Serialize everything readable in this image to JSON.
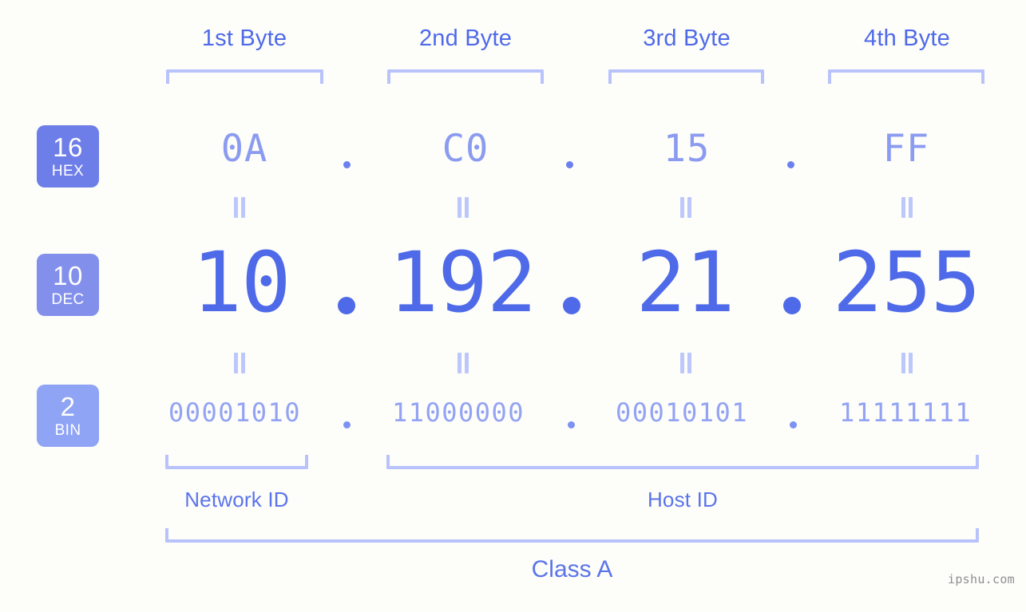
{
  "meta": {
    "watermark": "ipshu.com",
    "background_color": "#fdfdfa",
    "accent_strong": "#4f6ae8",
    "accent_mid": "#8b9bf0",
    "accent_light": "#b9c3fb"
  },
  "byte_headers": [
    {
      "label": "1st Byte"
    },
    {
      "label": "2nd Byte"
    },
    {
      "label": "3rd Byte"
    },
    {
      "label": "4th Byte"
    }
  ],
  "bases": [
    {
      "number": "16",
      "abbr": "HEX",
      "color": "#6e7ee8"
    },
    {
      "number": "10",
      "abbr": "DEC",
      "color": "#8290ec"
    },
    {
      "number": "2",
      "abbr": "BIN",
      "color": "#8fa4f5"
    }
  ],
  "rows": {
    "hex": {
      "values": [
        "0A",
        "C0",
        "15",
        "FF"
      ],
      "separator": "."
    },
    "dec": {
      "values": [
        "10",
        "192",
        "21",
        "255"
      ],
      "separator": "."
    },
    "bin": {
      "values": [
        "00001010",
        "11000000",
        "00010101",
        "11111111"
      ],
      "separator": "."
    }
  },
  "equality_symbol": "=",
  "regions": [
    {
      "label": "Network ID"
    },
    {
      "label": "Host ID"
    }
  ],
  "class": {
    "label": "Class A"
  }
}
